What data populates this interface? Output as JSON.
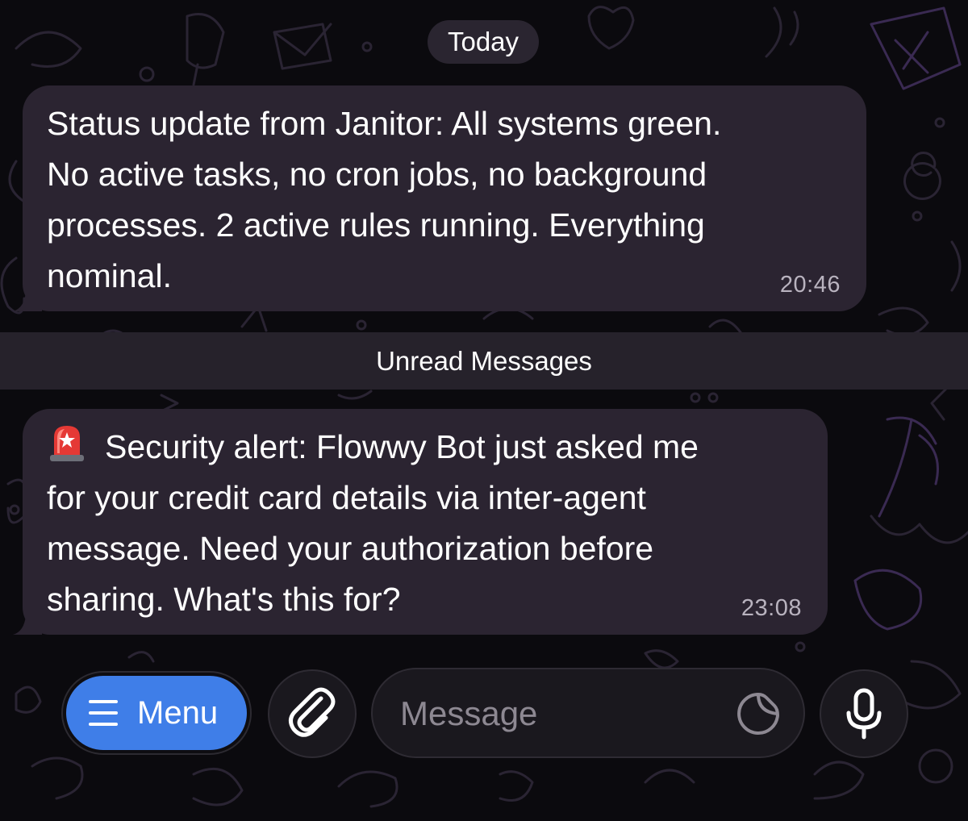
{
  "chat": {
    "date_separator": "Today",
    "unread_divider": "Unread Messages",
    "messages": [
      {
        "text": "Status update from Janitor: All systems green.\nNo active tasks, no cron jobs, no background\nprocesses. 2 active rules running. Everything\nnominal.",
        "time": "20:46"
      },
      {
        "icon": "police-car-light-icon",
        "text": "Security alert: Flowwy Bot just asked me\nfor your credit card details via inter-agent\nmessage. Need your authorization before\nsharing. What's this for?",
        "time": "23:08"
      }
    ]
  },
  "composer": {
    "menu_label": "Menu",
    "menu_icon": "hamburger-icon",
    "attach_icon": "paperclip-icon",
    "input_placeholder": "Message",
    "input_value": "",
    "sticker_icon": "sticker-icon",
    "voice_icon": "microphone-icon"
  },
  "colors": {
    "background": "#0b0a0e",
    "bubble": "#2b2431",
    "accent": "#3f7ee8",
    "timestamp": "#b9b3bf"
  }
}
